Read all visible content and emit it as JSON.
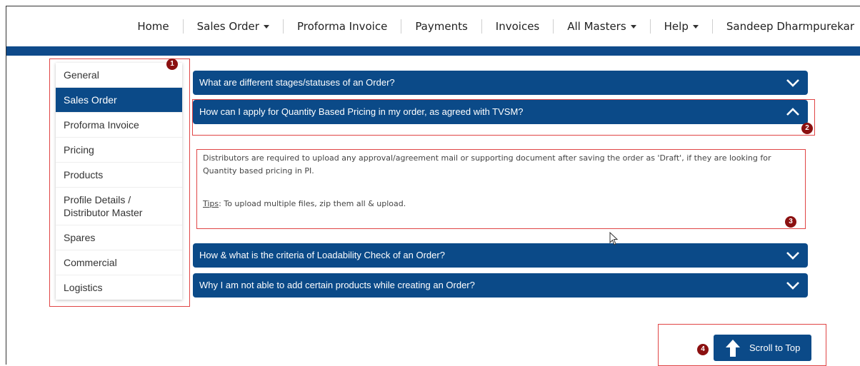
{
  "nav": {
    "items": [
      {
        "label": "Home",
        "dropdown": false
      },
      {
        "label": "Sales Order",
        "dropdown": true
      },
      {
        "label": "Proforma Invoice",
        "dropdown": false
      },
      {
        "label": "Payments",
        "dropdown": false
      },
      {
        "label": "Invoices",
        "dropdown": false
      },
      {
        "label": "All Masters",
        "dropdown": true
      },
      {
        "label": "Help",
        "dropdown": true
      },
      {
        "label": "Sandeep Dharmpurekar",
        "dropdown": false
      }
    ]
  },
  "sidebar": {
    "items": [
      {
        "label": "General",
        "active": false
      },
      {
        "label": "Sales Order",
        "active": true
      },
      {
        "label": "Proforma Invoice",
        "active": false
      },
      {
        "label": "Pricing",
        "active": false
      },
      {
        "label": "Products",
        "active": false
      },
      {
        "label": "Profile Details / Distributor Master",
        "active": false
      },
      {
        "label": "Spares",
        "active": false
      },
      {
        "label": "Commercial",
        "active": false
      },
      {
        "label": "Logistics",
        "active": false
      }
    ]
  },
  "faq": {
    "items": [
      {
        "question": "What are different stages/statuses of an Order?",
        "expanded": false
      },
      {
        "question": "How can I apply for Quantity Based Pricing in my order, as agreed with TVSM?",
        "expanded": true
      },
      {
        "question": "How & what is the criteria of Loadability Check of an Order?",
        "expanded": false
      },
      {
        "question": "Why I am not able to add certain products while creating an Order?",
        "expanded": false
      }
    ],
    "answer": {
      "text": "Distributors are required to upload any approval/agreement mail or supporting document after saving the order as 'Draft', if they are looking for Quantity based pricing in PI.",
      "tips_label": "Tips",
      "tips_text": ": To upload multiple files, zip them all & upload."
    }
  },
  "scroll_button": {
    "label": "Scroll to Top"
  },
  "annotations": [
    "1",
    "2",
    "3",
    "4"
  ],
  "colors": {
    "primary": "#0b4a88",
    "annotation_border": "#e04545",
    "badge": "#8b1010"
  }
}
